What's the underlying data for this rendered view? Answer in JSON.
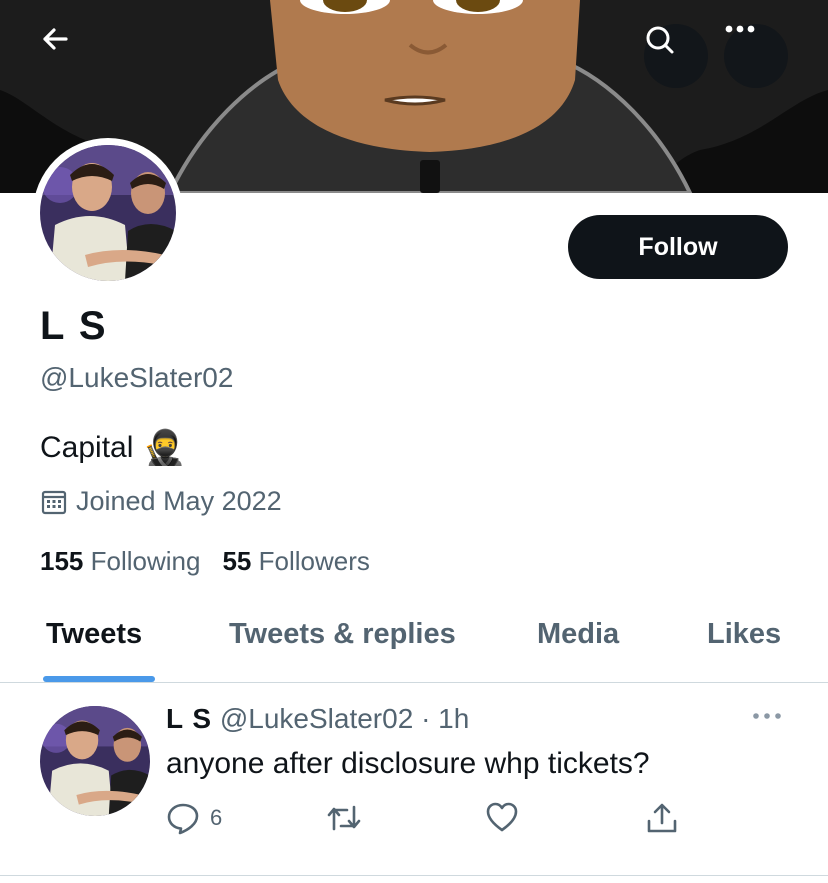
{
  "profile": {
    "name": "L S",
    "handle": "@LukeSlater02",
    "bio_text": "Capital",
    "bio_emoji": "🥷",
    "joined": "Joined May 2022",
    "following_count": "155",
    "following_label": "Following",
    "followers_count": "55",
    "followers_label": "Followers"
  },
  "header": {
    "back_icon": "arrow-left-icon",
    "search_icon": "search-icon",
    "more_icon": "more-horizontal-icon"
  },
  "follow_button": {
    "label": "Follow"
  },
  "tabs": [
    {
      "label": "Tweets",
      "active": true
    },
    {
      "label": "Tweets & replies",
      "active": false
    },
    {
      "label": "Media",
      "active": false
    },
    {
      "label": "Likes",
      "active": false
    }
  ],
  "tweet": {
    "name": "L S",
    "handle": "@LukeSlater02",
    "separator": "·",
    "time": "1h",
    "text": "anyone after disclosure whp tickets?",
    "reply_count": "6",
    "icons": [
      "reply-icon",
      "retweet-icon",
      "like-icon",
      "share-icon"
    ]
  },
  "colors": {
    "accent": "#4a99e9",
    "text_primary": "#0f1419",
    "text_secondary": "#536471",
    "follow_bg": "#0f1419"
  }
}
